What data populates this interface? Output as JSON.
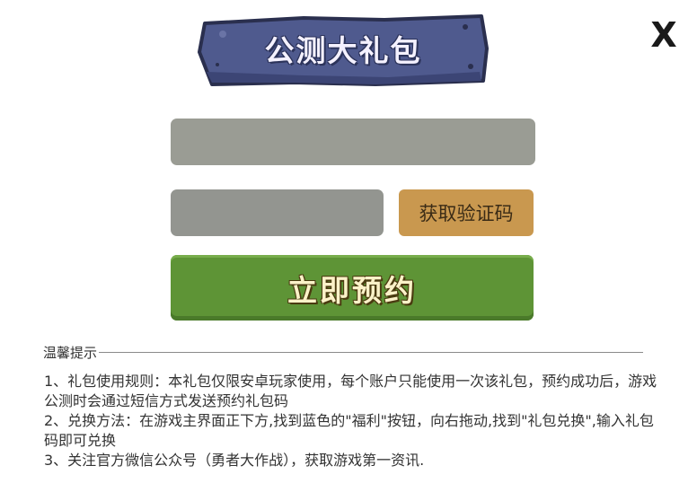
{
  "header": {
    "title": "公测大礼包",
    "close_label": "X"
  },
  "form": {
    "phone_placeholder": "",
    "code_placeholder": "",
    "get_code_label": "获取验证码",
    "reserve_label": "立即预约"
  },
  "tips": {
    "title": "温馨提示",
    "items": [
      "1、礼包使用规则：本礼包仅限安卓玩家使用，每个账户只能使用一次该礼包，预约成功后，游戏公测时会通过短信方式发送预约礼包码",
      "2、兑换方法：在游戏主界面正下方,找到蓝色的\"福利\"按钮，向右拖动,找到\"礼包兑换\",输入礼包码即可兑换",
      "3、关注官方微信公众号（勇者大作战），获取游戏第一资讯."
    ]
  },
  "colors": {
    "banner": "#4a5488",
    "input_bg": "#9a9c94",
    "code_button": "#c9984f",
    "reserve_button": "#5e9436"
  }
}
